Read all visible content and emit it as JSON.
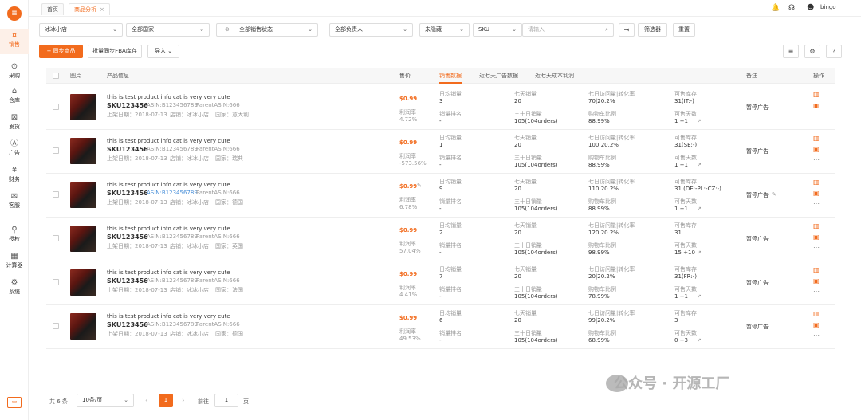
{
  "sidebar": {
    "items": [
      {
        "label": "销售",
        "icon": "¤"
      },
      {
        "label": "采购",
        "icon": "⊙"
      },
      {
        "label": "仓库",
        "icon": "⌂"
      },
      {
        "label": "发货",
        "icon": "⊠"
      },
      {
        "label": "广告",
        "icon": "Ⓐ"
      },
      {
        "label": "财务",
        "icon": "¥"
      },
      {
        "label": "客服",
        "icon": "✉"
      },
      {
        "label": "授权",
        "icon": "⚲"
      },
      {
        "label": "计算器",
        "icon": "▦"
      },
      {
        "label": "系统",
        "icon": "⚙"
      }
    ]
  },
  "tabs": [
    {
      "label": "首页"
    },
    {
      "label": "商品分析",
      "close": "×"
    }
  ],
  "header": {
    "user": "bingo"
  },
  "filters": {
    "shop": "冰冰小店",
    "country": "全部国家",
    "status": "全部销售状态",
    "owner": "全部负责人",
    "hidden": "未隐藏",
    "sku_type": "SKU",
    "search_placeholder": "请输入",
    "filter_btn": "筛选器",
    "reset_btn": "重置"
  },
  "toolbar": {
    "sync": "+ 同步商品",
    "fba": "批量同步FBA库存",
    "import": "导入"
  },
  "table": {
    "headers": {
      "image": "图片",
      "info": "产品信息",
      "price": "售价",
      "tab1": "销售数据",
      "tab2": "近七天广告数据",
      "tab3": "近七天成本利润",
      "remark": "备注",
      "action": "操作"
    },
    "labels": {
      "profit": "利润率",
      "daily": "日均销量",
      "rank": "销量排名",
      "seven": "七天销量",
      "thirty": "三十日销量",
      "conv7": "七日访问量|转化率",
      "cart": "购物车比例",
      "stock": "可售库存",
      "days": "可售天数",
      "listed": "上架日期：",
      "shop": "店铺：",
      "country": "国家："
    },
    "rows": [
      {
        "title": "this is test product info cat is very very cute",
        "sku": "SKU123456",
        "asin": "ASIN:B123456789",
        "parent": "ParentASIN:666",
        "date": "2018-07-13",
        "shop": "冰冰小店",
        "country": "意大利",
        "price": "$0.99",
        "profit": "4.72%",
        "daily": "3",
        "rank": "-",
        "seven": "20",
        "thirty": "105(104orders)",
        "conv": "70|20.2%",
        "cart": "88.99%",
        "stock": "31(IT:-)",
        "days": "1 +1",
        "remark": "暂停广告"
      },
      {
        "title": "this is test product info cat is very very cute",
        "sku": "SKU123456",
        "asin": "ASIN:B123456789",
        "parent": "ParentASIN:666",
        "date": "2018-07-13",
        "shop": "冰冰小店",
        "country": "瑞典",
        "price": "$0.99",
        "profit": "-573.56%",
        "daily": "1",
        "rank": "-",
        "seven": "20",
        "thirty": "105(104orders)",
        "conv": "100|20.2%",
        "cart": "88.99%",
        "stock": "31(SE:-)",
        "days": "1 +1",
        "remark": "暂停广告"
      },
      {
        "title": "this is test product info cat is very very cute",
        "sku": "SKU123456",
        "asin": "ASIN:B123456789",
        "parent": "ParentASIN:666",
        "date": "2018-07-13",
        "shop": "冰冰小店",
        "country": "德国",
        "price": "$0.99",
        "profit": "6.78%",
        "daily": "9",
        "rank": "-",
        "seven": "20",
        "thirty": "105(104orders)",
        "conv": "110|20.2%",
        "cart": "88.99%",
        "stock": "31 (DE:-PL:-CZ:-)",
        "days": "1 +1",
        "remark": "暂停广告"
      },
      {
        "title": "this is test product info cat is very very cute",
        "sku": "SKU123456",
        "asin": "ASIN:B123456789",
        "parent": "ParentASIN:666",
        "date": "2018-07-13",
        "shop": "冰冰小店",
        "country": "英国",
        "price": "$0.99",
        "profit": "57.04%",
        "daily": "2",
        "rank": "-",
        "seven": "20",
        "thirty": "105(104orders)",
        "conv": "120|20.2%",
        "cart": "98.99%",
        "stock": "31",
        "days": "15 +10",
        "remark": "暂停广告"
      },
      {
        "title": "this is test product info cat is very very cute",
        "sku": "SKU123456",
        "asin": "ASIN:B123456789",
        "parent": "ParentASIN:666",
        "date": "2018-07-13",
        "shop": "冰冰小店",
        "country": "法国",
        "price": "$0.99",
        "profit": "4.41%",
        "daily": "7",
        "rank": "-",
        "seven": "20",
        "thirty": "105(104orders)",
        "conv": "20|20.2%",
        "cart": "78.99%",
        "stock": "31(FR:-)",
        "days": "1 +1",
        "remark": "暂停广告"
      },
      {
        "title": "this is test product info cat is very very cute",
        "sku": "SKU123456",
        "asin": "ASIN:B123456789",
        "parent": "ParentASIN:666",
        "date": "2018-07-13",
        "shop": "冰冰小店",
        "country": "德国",
        "price": "$0.99",
        "profit": "49.53%",
        "daily": "6",
        "rank": "-",
        "seven": "20",
        "thirty": "105(104orders)",
        "conv": "99|20.2%",
        "cart": "68.99%",
        "stock": "3",
        "days": "0 +3",
        "remark": "暂停广告"
      }
    ]
  },
  "pagination": {
    "total": "共 6 条",
    "per_page": "10条/页",
    "current": "1",
    "goto": "前往",
    "goto_val": "1",
    "page": "页",
    "prev": "‹",
    "next": "›"
  },
  "watermark": {
    "text": "公众号 · 开源工厂"
  },
  "colors": {
    "accent": "#f26b1d",
    "link": "#4a90d9"
  }
}
